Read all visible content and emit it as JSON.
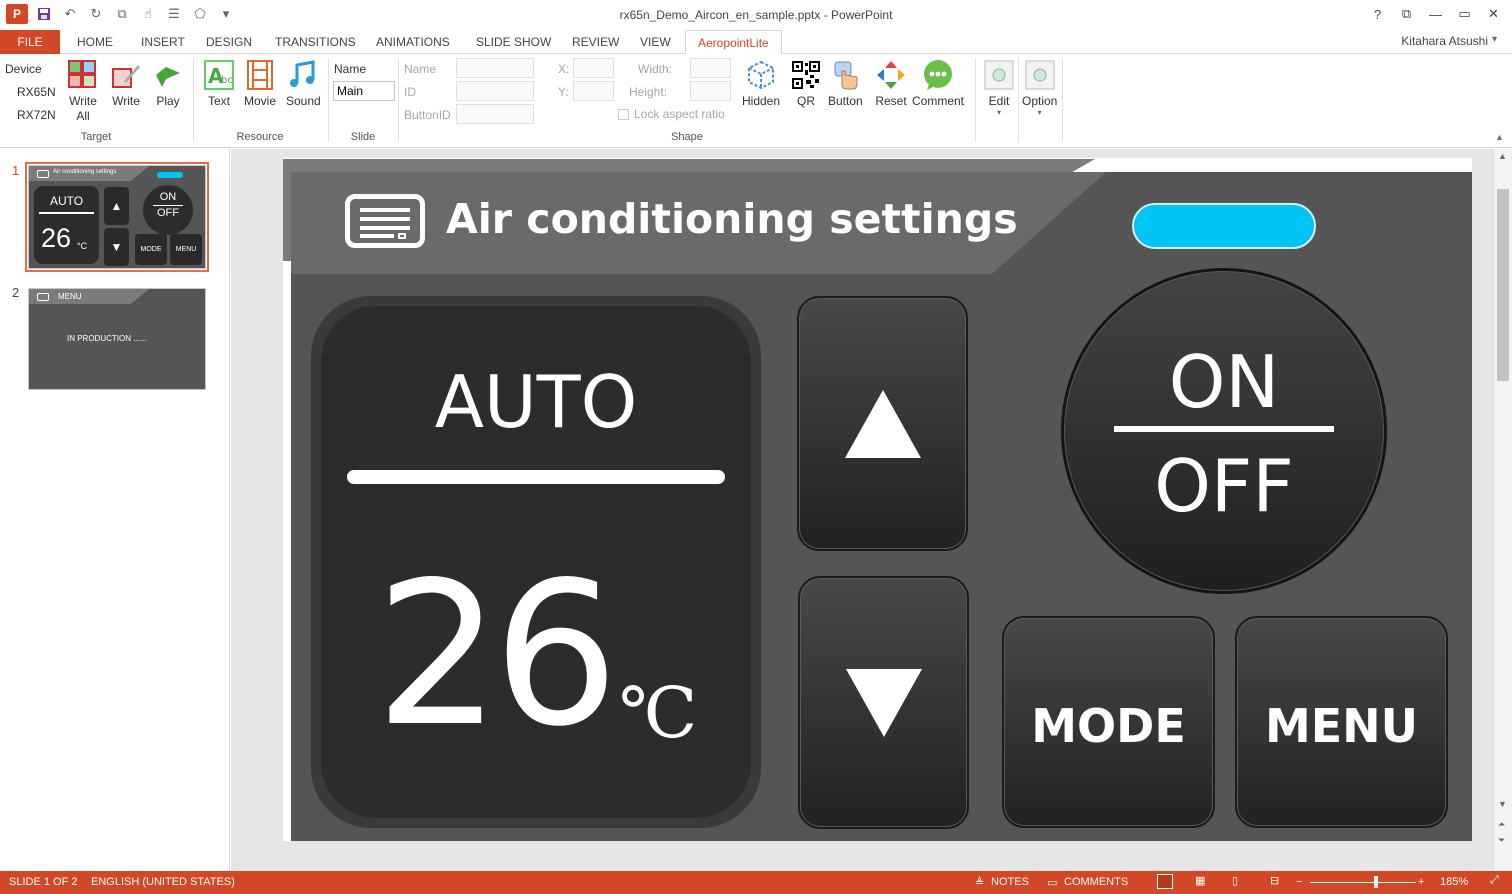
{
  "titlebar": {
    "title": "rx65n_Demo_Aircon_en_sample.pptx - PowerPoint",
    "help": "?",
    "minimize": "—",
    "restore": "▭",
    "close": "✕",
    "ribbon_display": "⧉"
  },
  "tabs": {
    "file": "FILE",
    "items": [
      "HOME",
      "INSERT",
      "DESIGN",
      "TRANSITIONS",
      "ANIMATIONS",
      "SLIDE SHOW",
      "REVIEW",
      "VIEW"
    ],
    "active": "AeropointLite",
    "user": "Kitahara Atsushi"
  },
  "ribbon": {
    "device_label": "Device",
    "devices": [
      "RX65N",
      "RX72N"
    ],
    "write_all": "Write\nAll",
    "write_all_1": "Write",
    "write_all_2": "All",
    "write": "Write",
    "play": "Play",
    "group_target": "Target",
    "text": "Text",
    "movie": "Movie",
    "sound": "Sound",
    "group_resource": "Resource",
    "name_label": "Name",
    "name_value": "Main",
    "group_slide": "Slide",
    "shape_name": "Name",
    "shape_id": "ID",
    "shape_buttonid": "ButtonID",
    "x_label": "X:",
    "y_label": "Y:",
    "width_label": "Width:",
    "height_label": "Height:",
    "lock_label": "Lock aspect ratio",
    "hidden": "Hidden",
    "qr": "QR",
    "button": "Button",
    "reset": "Reset",
    "comment": "Comment",
    "group_shape": "Shape",
    "edit": "Edit",
    "option": "Option"
  },
  "slides": {
    "numbers": [
      "1",
      "2"
    ],
    "thumb1": {
      "title": "Air conditioning settings",
      "mode": "AUTO",
      "temp": "26",
      "unit": "°C",
      "on": "ON",
      "off": "OFF",
      "mode_btn": "MODE",
      "menu_btn": "MENU"
    },
    "thumb2": {
      "title": "MENU",
      "body": "IN PRODUCTION ......"
    }
  },
  "slide": {
    "header_title": "Air conditioning settings",
    "mode": "AUTO",
    "temp": "26",
    "unit": "℃",
    "on": "ON",
    "off": "OFF",
    "mode_button": "MODE",
    "menu_button": "MENU"
  },
  "statusbar": {
    "slide_info": "SLIDE 1 OF 2",
    "language": "ENGLISH (UNITED STATES)",
    "notes": "NOTES",
    "comments": "COMMENTS",
    "zoom": "185%",
    "zoom_minus": "−",
    "zoom_plus": "+"
  },
  "colors": {
    "accent": "#d24726",
    "led": "#00c4f4",
    "panel": "#555555"
  },
  "icons": [
    "powerpoint-logo-icon",
    "save-icon",
    "undo-icon",
    "redo-icon",
    "start-from-beginning-icon",
    "touch-mode-icon",
    "customize-icon",
    "write-all-icon",
    "write-icon",
    "play-icon",
    "text-icon",
    "movie-icon",
    "sound-icon",
    "hidden-icon",
    "qr-icon",
    "button-icon",
    "reset-icon",
    "comment-icon",
    "edit-icon",
    "option-icon",
    "air-conditioner-icon",
    "up-arrow-icon",
    "down-arrow-icon"
  ]
}
